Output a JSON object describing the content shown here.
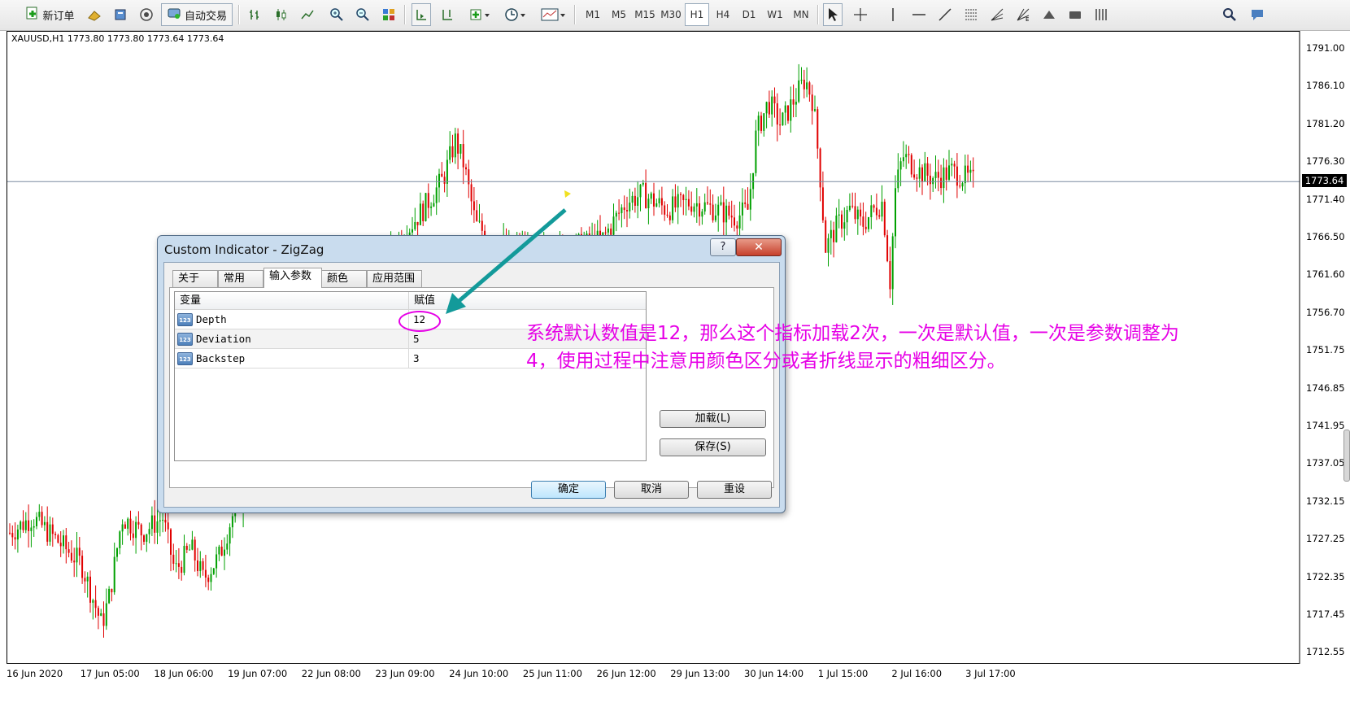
{
  "toolbar": {
    "new_order_label": "新订单",
    "auto_trade_label": "自动交易",
    "timeframes": [
      {
        "label": "M1",
        "active": false
      },
      {
        "label": "M5",
        "active": false
      },
      {
        "label": "M15",
        "active": false
      },
      {
        "label": "M30",
        "active": false
      },
      {
        "label": "H1",
        "active": true
      },
      {
        "label": "H4",
        "active": false
      },
      {
        "label": "D1",
        "active": false
      },
      {
        "label": "W1",
        "active": false
      },
      {
        "label": "MN",
        "active": false
      }
    ]
  },
  "chart": {
    "symbol_info": "XAUUSD,H1  1773.80 1773.80 1773.64 1773.64",
    "current_price": "1773.64",
    "price_labels": [
      "1791.00",
      "1786.10",
      "1781.20",
      "1776.30",
      "1771.40",
      "1766.50",
      "1761.60",
      "1756.70",
      "1751.75",
      "1746.85",
      "1741.95",
      "1737.05",
      "1732.15",
      "1727.25",
      "1722.35",
      "1717.45",
      "1712.55"
    ],
    "time_labels": [
      "16 Jun 2020",
      "17 Jun 05:00",
      "18 Jun 06:00",
      "19 Jun 07:00",
      "22 Jun 08:00",
      "23 Jun 09:00",
      "24 Jun 10:00",
      "25 Jun 11:00",
      "26 Jun 12:00",
      "29 Jun 13:00",
      "30 Jun 14:00",
      "1 Jul 15:00",
      "2 Jul 16:00",
      "3 Jul 17:00"
    ],
    "up_color": "#00a000",
    "down_color": "#e00000"
  },
  "dialog": {
    "title": "Custom Indicator - ZigZag",
    "help_label": "?",
    "close_label": "✕",
    "tabs": [
      {
        "label": "关于",
        "selected": false
      },
      {
        "label": "常用",
        "selected": false
      },
      {
        "label": "输入参数",
        "selected": true
      },
      {
        "label": "颜色",
        "selected": false
      },
      {
        "label": "应用范围",
        "selected": false
      }
    ],
    "table_headers": {
      "variable": "变量",
      "value": "赋值"
    },
    "params": [
      {
        "badge": "123",
        "name": "Depth",
        "value": "12"
      },
      {
        "badge": "123",
        "name": "Deviation",
        "value": "5"
      },
      {
        "badge": "123",
        "name": "Backstep",
        "value": "3"
      }
    ],
    "load_label": "加载(L)",
    "save_label": "保存(S)",
    "ok_label": "确定",
    "cancel_label": "取消",
    "reset_label": "重设"
  },
  "annotation": {
    "text": "系统默认数值是12，那么这个指标加载2次，一次是默认值，一次是参数调整为4，使用过程中注意用颜色区分或者折线显示的粗细区分。",
    "color": "#e600e6"
  }
}
